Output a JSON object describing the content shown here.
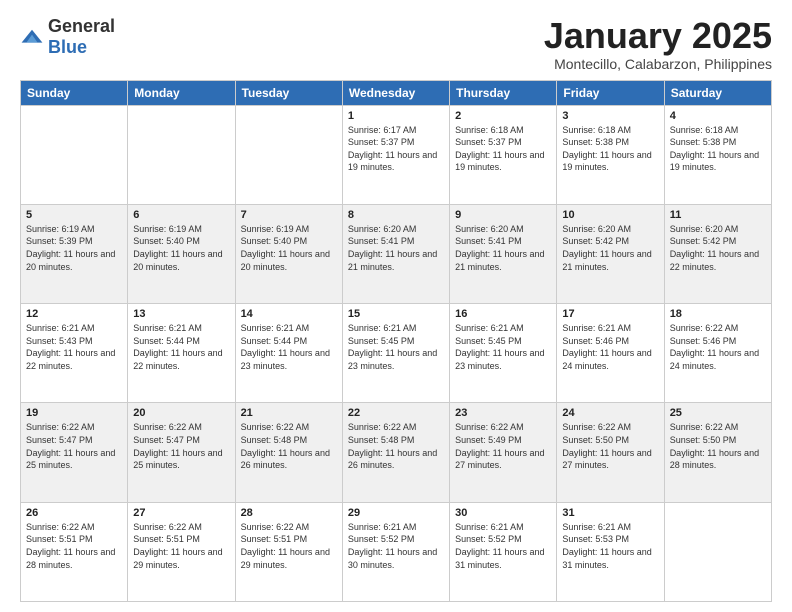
{
  "header": {
    "logo_general": "General",
    "logo_blue": "Blue",
    "month_year": "January 2025",
    "location": "Montecillo, Calabarzon, Philippines"
  },
  "days_of_week": [
    "Sunday",
    "Monday",
    "Tuesday",
    "Wednesday",
    "Thursday",
    "Friday",
    "Saturday"
  ],
  "weeks": [
    [
      {
        "day": "",
        "sunrise": "",
        "sunset": "",
        "daylight": ""
      },
      {
        "day": "",
        "sunrise": "",
        "sunset": "",
        "daylight": ""
      },
      {
        "day": "",
        "sunrise": "",
        "sunset": "",
        "daylight": ""
      },
      {
        "day": "1",
        "sunrise": "Sunrise: 6:17 AM",
        "sunset": "Sunset: 5:37 PM",
        "daylight": "Daylight: 11 hours and 19 minutes."
      },
      {
        "day": "2",
        "sunrise": "Sunrise: 6:18 AM",
        "sunset": "Sunset: 5:37 PM",
        "daylight": "Daylight: 11 hours and 19 minutes."
      },
      {
        "day": "3",
        "sunrise": "Sunrise: 6:18 AM",
        "sunset": "Sunset: 5:38 PM",
        "daylight": "Daylight: 11 hours and 19 minutes."
      },
      {
        "day": "4",
        "sunrise": "Sunrise: 6:18 AM",
        "sunset": "Sunset: 5:38 PM",
        "daylight": "Daylight: 11 hours and 19 minutes."
      }
    ],
    [
      {
        "day": "5",
        "sunrise": "Sunrise: 6:19 AM",
        "sunset": "Sunset: 5:39 PM",
        "daylight": "Daylight: 11 hours and 20 minutes."
      },
      {
        "day": "6",
        "sunrise": "Sunrise: 6:19 AM",
        "sunset": "Sunset: 5:40 PM",
        "daylight": "Daylight: 11 hours and 20 minutes."
      },
      {
        "day": "7",
        "sunrise": "Sunrise: 6:19 AM",
        "sunset": "Sunset: 5:40 PM",
        "daylight": "Daylight: 11 hours and 20 minutes."
      },
      {
        "day": "8",
        "sunrise": "Sunrise: 6:20 AM",
        "sunset": "Sunset: 5:41 PM",
        "daylight": "Daylight: 11 hours and 21 minutes."
      },
      {
        "day": "9",
        "sunrise": "Sunrise: 6:20 AM",
        "sunset": "Sunset: 5:41 PM",
        "daylight": "Daylight: 11 hours and 21 minutes."
      },
      {
        "day": "10",
        "sunrise": "Sunrise: 6:20 AM",
        "sunset": "Sunset: 5:42 PM",
        "daylight": "Daylight: 11 hours and 21 minutes."
      },
      {
        "day": "11",
        "sunrise": "Sunrise: 6:20 AM",
        "sunset": "Sunset: 5:42 PM",
        "daylight": "Daylight: 11 hours and 22 minutes."
      }
    ],
    [
      {
        "day": "12",
        "sunrise": "Sunrise: 6:21 AM",
        "sunset": "Sunset: 5:43 PM",
        "daylight": "Daylight: 11 hours and 22 minutes."
      },
      {
        "day": "13",
        "sunrise": "Sunrise: 6:21 AM",
        "sunset": "Sunset: 5:44 PM",
        "daylight": "Daylight: 11 hours and 22 minutes."
      },
      {
        "day": "14",
        "sunrise": "Sunrise: 6:21 AM",
        "sunset": "Sunset: 5:44 PM",
        "daylight": "Daylight: 11 hours and 23 minutes."
      },
      {
        "day": "15",
        "sunrise": "Sunrise: 6:21 AM",
        "sunset": "Sunset: 5:45 PM",
        "daylight": "Daylight: 11 hours and 23 minutes."
      },
      {
        "day": "16",
        "sunrise": "Sunrise: 6:21 AM",
        "sunset": "Sunset: 5:45 PM",
        "daylight": "Daylight: 11 hours and 23 minutes."
      },
      {
        "day": "17",
        "sunrise": "Sunrise: 6:21 AM",
        "sunset": "Sunset: 5:46 PM",
        "daylight": "Daylight: 11 hours and 24 minutes."
      },
      {
        "day": "18",
        "sunrise": "Sunrise: 6:22 AM",
        "sunset": "Sunset: 5:46 PM",
        "daylight": "Daylight: 11 hours and 24 minutes."
      }
    ],
    [
      {
        "day": "19",
        "sunrise": "Sunrise: 6:22 AM",
        "sunset": "Sunset: 5:47 PM",
        "daylight": "Daylight: 11 hours and 25 minutes."
      },
      {
        "day": "20",
        "sunrise": "Sunrise: 6:22 AM",
        "sunset": "Sunset: 5:47 PM",
        "daylight": "Daylight: 11 hours and 25 minutes."
      },
      {
        "day": "21",
        "sunrise": "Sunrise: 6:22 AM",
        "sunset": "Sunset: 5:48 PM",
        "daylight": "Daylight: 11 hours and 26 minutes."
      },
      {
        "day": "22",
        "sunrise": "Sunrise: 6:22 AM",
        "sunset": "Sunset: 5:48 PM",
        "daylight": "Daylight: 11 hours and 26 minutes."
      },
      {
        "day": "23",
        "sunrise": "Sunrise: 6:22 AM",
        "sunset": "Sunset: 5:49 PM",
        "daylight": "Daylight: 11 hours and 27 minutes."
      },
      {
        "day": "24",
        "sunrise": "Sunrise: 6:22 AM",
        "sunset": "Sunset: 5:50 PM",
        "daylight": "Daylight: 11 hours and 27 minutes."
      },
      {
        "day": "25",
        "sunrise": "Sunrise: 6:22 AM",
        "sunset": "Sunset: 5:50 PM",
        "daylight": "Daylight: 11 hours and 28 minutes."
      }
    ],
    [
      {
        "day": "26",
        "sunrise": "Sunrise: 6:22 AM",
        "sunset": "Sunset: 5:51 PM",
        "daylight": "Daylight: 11 hours and 28 minutes."
      },
      {
        "day": "27",
        "sunrise": "Sunrise: 6:22 AM",
        "sunset": "Sunset: 5:51 PM",
        "daylight": "Daylight: 11 hours and 29 minutes."
      },
      {
        "day": "28",
        "sunrise": "Sunrise: 6:22 AM",
        "sunset": "Sunset: 5:51 PM",
        "daylight": "Daylight: 11 hours and 29 minutes."
      },
      {
        "day": "29",
        "sunrise": "Sunrise: 6:21 AM",
        "sunset": "Sunset: 5:52 PM",
        "daylight": "Daylight: 11 hours and 30 minutes."
      },
      {
        "day": "30",
        "sunrise": "Sunrise: 6:21 AM",
        "sunset": "Sunset: 5:52 PM",
        "daylight": "Daylight: 11 hours and 31 minutes."
      },
      {
        "day": "31",
        "sunrise": "Sunrise: 6:21 AM",
        "sunset": "Sunset: 5:53 PM",
        "daylight": "Daylight: 11 hours and 31 minutes."
      },
      {
        "day": "",
        "sunrise": "",
        "sunset": "",
        "daylight": ""
      }
    ]
  ]
}
